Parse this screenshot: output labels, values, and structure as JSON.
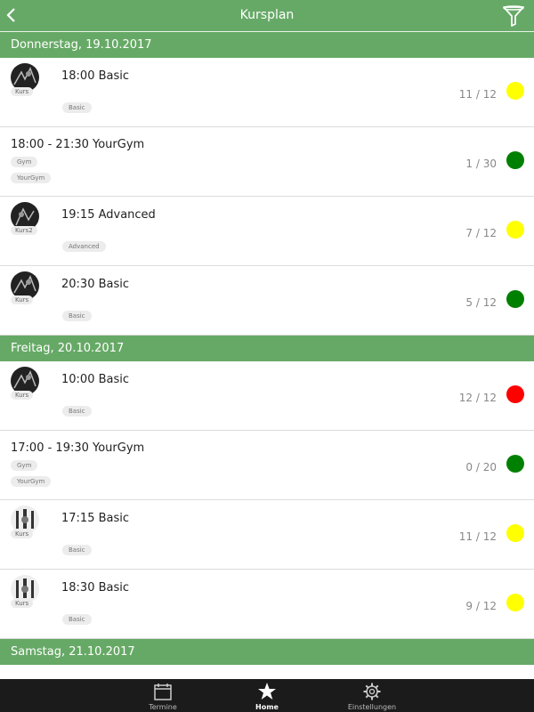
{
  "header": {
    "title": "Kursplan"
  },
  "sections": [
    {
      "date": "Donnerstag, 19.10.2017",
      "rows": [
        {
          "title": "18:00 Basic",
          "avatar_tag": "Kurs",
          "tag": "Basic",
          "count": "11 / 12",
          "status": "yellow"
        },
        {
          "title": "18:00 - 21:30 YourGym",
          "tag1": "Gym",
          "tag2": "YourGym",
          "count": "1 / 30",
          "status": "green"
        },
        {
          "title": "19:15 Advanced",
          "avatar_tag": "Kurs2",
          "tag": "Advanced",
          "count": "7 / 12",
          "status": "yellow"
        },
        {
          "title": "20:30 Basic",
          "avatar_tag": "Kurs",
          "tag": "Basic",
          "count": "5 / 12",
          "status": "green"
        }
      ]
    },
    {
      "date": "Freitag, 20.10.2017",
      "rows": [
        {
          "title": "10:00 Basic",
          "avatar_tag": "Kurs",
          "tag": "Basic",
          "count": "12 / 12",
          "status": "red"
        },
        {
          "title": "17:00 - 19:30 YourGym",
          "tag1": "Gym",
          "tag2": "YourGym",
          "count": "0 / 20",
          "status": "green"
        },
        {
          "title": "17:15 Basic",
          "avatar_tag": "Kurs",
          "tag": "Basic",
          "count": "11 / 12",
          "status": "yellow"
        },
        {
          "title": "18:30 Basic",
          "avatar_tag": "Kurs",
          "tag": "Basic",
          "count": "9 / 12",
          "status": "yellow"
        }
      ]
    },
    {
      "date": "Samstag, 21.10.2017",
      "rows": []
    }
  ],
  "status_colors": {
    "yellow": "#ffff00",
    "green": "#008000",
    "red": "#ff0000"
  },
  "tabbar": {
    "tabs": [
      {
        "label": "Termine",
        "icon": "calendar-icon"
      },
      {
        "label": "Home",
        "icon": "star-icon",
        "active": true
      },
      {
        "label": "Einstellungen",
        "icon": "gear-icon"
      }
    ]
  }
}
